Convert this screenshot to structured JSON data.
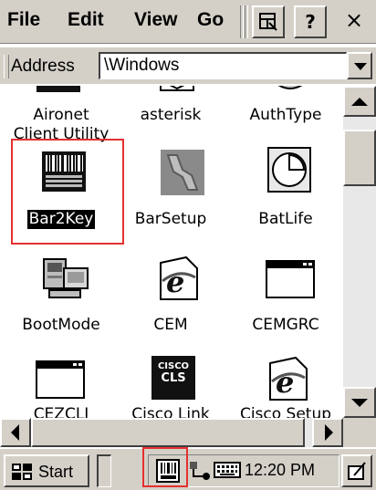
{
  "menubar": {
    "file": "File",
    "edit": "Edit",
    "view": "View",
    "go": "Go",
    "help_label": "?",
    "close_label": "×"
  },
  "address": {
    "label": "Address",
    "value": "\\Windows"
  },
  "items": [
    {
      "label": "Aironet",
      "label2": "Client Utility",
      "icon": "aironet-icon"
    },
    {
      "label": "asterisk",
      "icon": "asterisk-icon"
    },
    {
      "label": "AuthType",
      "icon": "authtype-icon"
    },
    {
      "label": "Bar2Key",
      "icon": "barcode-icon",
      "selected": true
    },
    {
      "label": "BarSetup",
      "icon": "barsetup-icon"
    },
    {
      "label": "BatLife",
      "icon": "clock-icon"
    },
    {
      "label": "BootMode",
      "icon": "computer-icon"
    },
    {
      "label": "CEM",
      "icon": "ie-icon"
    },
    {
      "label": "CEMGRC",
      "icon": "window-icon"
    },
    {
      "label": "CEZCLI",
      "icon": "window-icon"
    },
    {
      "label": "Cisco Link",
      "icon": "cisco-cls-icon",
      "icon_text1": "CISCO",
      "icon_text2": "CLS"
    },
    {
      "label": "Cisco Setup",
      "icon": "ie-icon"
    }
  ],
  "taskbar": {
    "start_label": "Start",
    "clock": "12:20 PM"
  },
  "colors": {
    "chrome": "#d4d0c8",
    "highlight_box": "#e53030",
    "selection": "#000000"
  }
}
